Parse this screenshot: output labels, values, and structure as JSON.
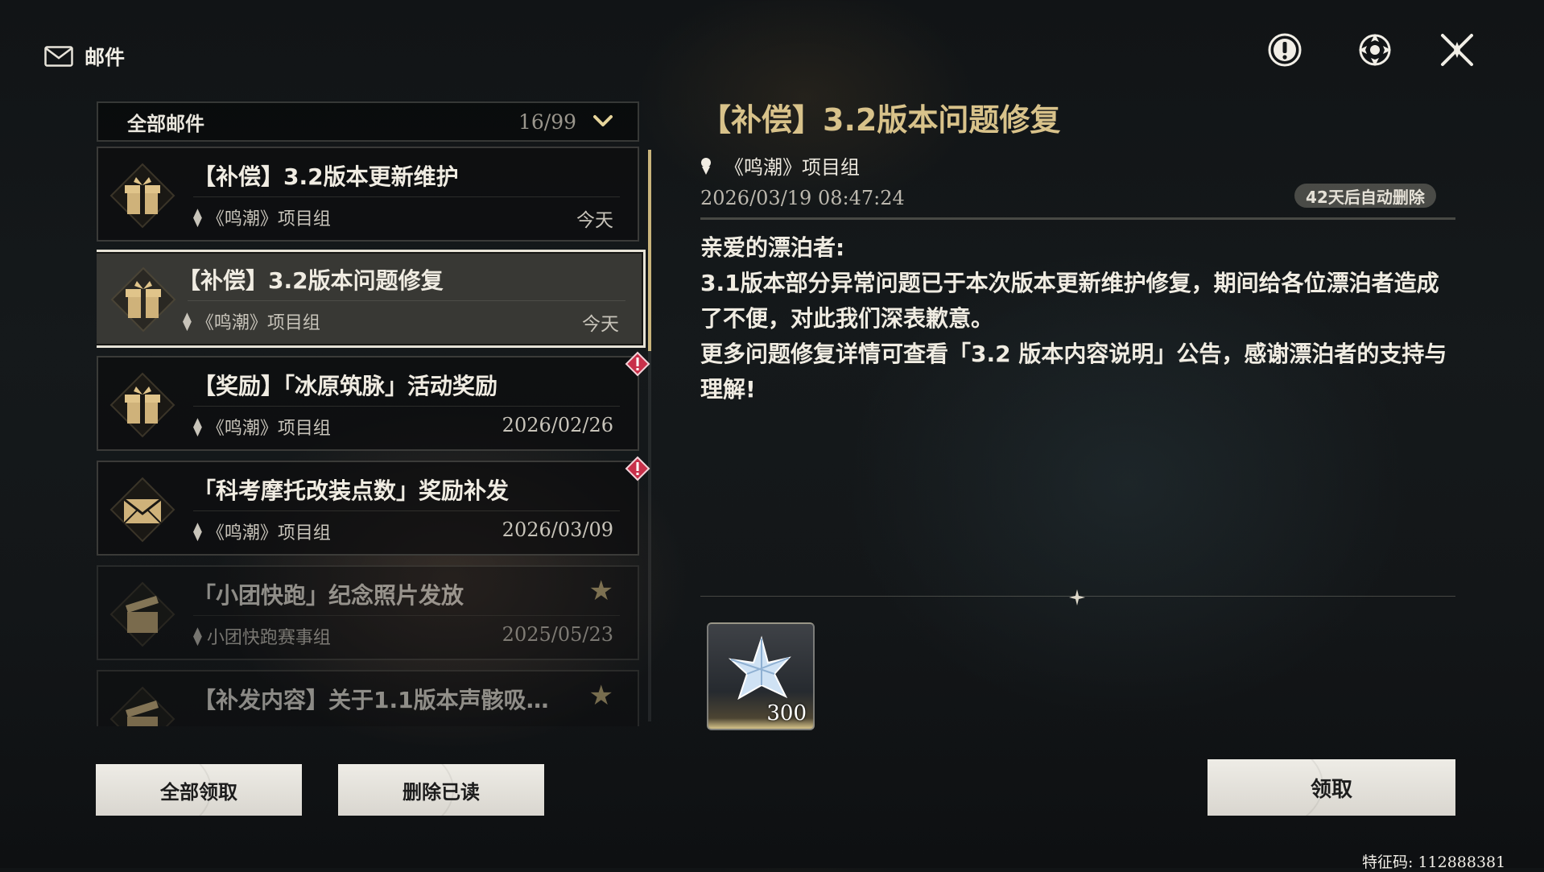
{
  "header": {
    "title": "邮件"
  },
  "filter": {
    "label": "全部邮件",
    "count": "16/99"
  },
  "mails": [
    {
      "title": "【补偿】3.2版本更新维护",
      "sender": "《鸣潮》项目组",
      "date": "今天",
      "icon": "gift-box-icon"
    },
    {
      "title": "【补偿】3.2版本问题修复",
      "sender": "《鸣潮》项目组",
      "date": "今天",
      "icon": "gift-box-icon",
      "selected": true
    },
    {
      "title": "【奖励】「冰原筑脉」活动奖励",
      "sender": "《鸣潮》项目组",
      "date": "2026/02/26",
      "icon": "gift-box-icon",
      "new": true
    },
    {
      "title": "「科考摩托改装点数」奖励补发",
      "sender": "《鸣潮》项目组",
      "date": "2026/03/09",
      "icon": "envelope-icon",
      "new": true
    },
    {
      "title": "「小团快跑」纪念照片发放",
      "sender": "小团快跑赛事组",
      "date": "2025/05/23",
      "icon": "opened-gift-icon",
      "starred": true,
      "read": true
    },
    {
      "title": "【补发内容】关于1.1版本声骸吸…",
      "sender": "",
      "date": "",
      "icon": "opened-gift-icon",
      "starred": true,
      "read": true
    }
  ],
  "buttons": {
    "claim_all": "全部领取",
    "delete_read": "删除已读",
    "claim": "领取"
  },
  "detail": {
    "title": "【补偿】3.2版本问题修复",
    "sender": "《鸣潮》项目组",
    "datetime": "2026/03/19 08:47:24",
    "auto_delete": "42天后自动删除",
    "greeting": "亲爱的漂泊者:",
    "body": [
      "3.1版本部分异常问题已于本次版本更新维护修复，期间给各位漂泊者造成了不便，对此我们深表歉意。",
      "更多问题修复详情可查看「3.2 版本内容说明」公告，感谢漂泊者的支持与理解!"
    ],
    "reward": {
      "name": "star-crystal-icon",
      "quantity": "300"
    }
  },
  "footer": {
    "feature_code": "特征码: 112888381"
  },
  "colors": {
    "accent_gold": "#d8c28a",
    "new_badge": "#c8304a",
    "scroll_thumb": "#c9b47c"
  }
}
